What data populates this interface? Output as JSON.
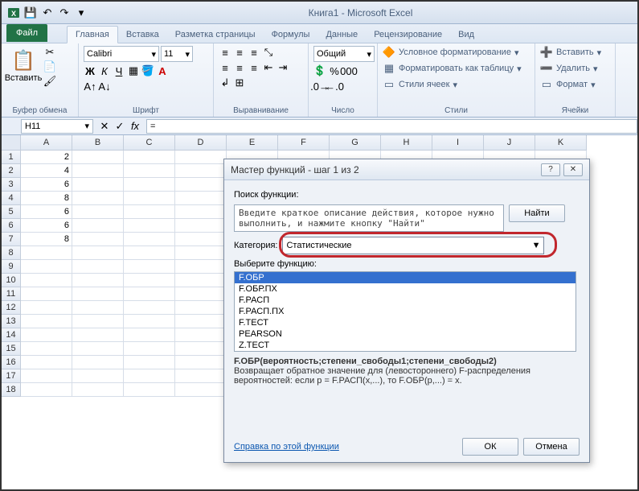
{
  "app_title": "Книга1 - Microsoft Excel",
  "qat": {
    "save": "💾",
    "undo": "↶",
    "redo": "↷"
  },
  "file_tab": "Файл",
  "tabs": [
    "Главная",
    "Вставка",
    "Разметка страницы",
    "Формулы",
    "Данные",
    "Рецензирование",
    "Вид"
  ],
  "active_tab": 0,
  "ribbon": {
    "clipboard": {
      "paste": "Вставить",
      "label": "Буфер обмена"
    },
    "font": {
      "name": "Calibri",
      "size": "11",
      "label": "Шрифт"
    },
    "align": {
      "label": "Выравнивание"
    },
    "number": {
      "format": "Общий",
      "label": "Число"
    },
    "styles": {
      "cond": "Условное форматирование",
      "table": "Форматировать как таблицу",
      "cell": "Стили ячеек",
      "label": "Стили"
    },
    "cells": {
      "insert": "Вставить",
      "delete": "Удалить",
      "format": "Формат",
      "label": "Ячейки"
    }
  },
  "name_box": "H11",
  "formula": "=",
  "columns": [
    "A",
    "B",
    "C",
    "D",
    "E",
    "F",
    "G",
    "H",
    "I",
    "J",
    "K"
  ],
  "rows": [
    1,
    2,
    3,
    4,
    5,
    6,
    7,
    8,
    9,
    10,
    11,
    12,
    13,
    14,
    15,
    16,
    17,
    18
  ],
  "data_a": [
    "2",
    "4",
    "6",
    "8",
    "6",
    "6",
    "8"
  ],
  "dialog": {
    "title": "Мастер функций - шаг 1 из 2",
    "search_label": "Поиск функции:",
    "search_text": "Введите краткое описание действия, которое нужно выполнить, и нажмите кнопку \"Найти\"",
    "find_btn": "Найти",
    "category_label": "Категория:",
    "category_value": "Статистические",
    "select_label": "Выберите функцию:",
    "functions": [
      "F.ОБР",
      "F.ОБР.ПХ",
      "F.РАСП",
      "F.РАСП.ПХ",
      "F.ТЕСТ",
      "PEARSON",
      "Z.ТЕСТ"
    ],
    "signature": "F.ОБР(вероятность;степени_свободы1;степени_свободы2)",
    "description": "Возвращает обратное значение для (левостороннего) F-распределения вероятностей: если p = F.РАСП(x,...), то F.ОБР(p,...) = x.",
    "help_link": "Справка по этой функции",
    "ok": "ОК",
    "cancel": "Отмена"
  }
}
